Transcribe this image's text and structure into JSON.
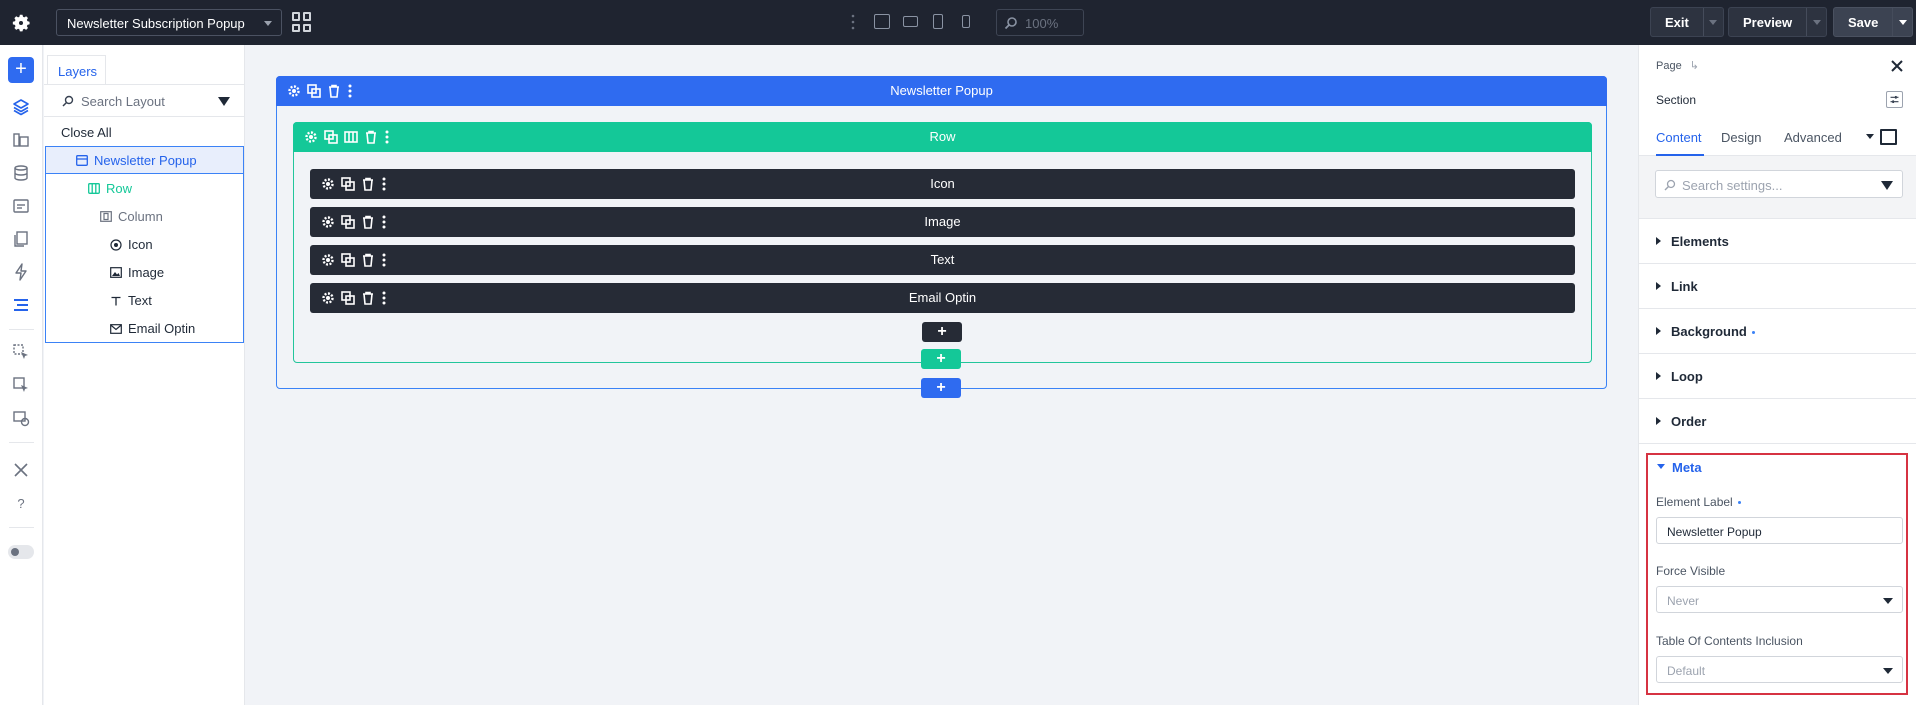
{
  "topbar": {
    "document_title": "Newsletter Subscription Popup",
    "zoom": "100%",
    "exit_label": "Exit",
    "preview_label": "Preview",
    "save_label": "Save"
  },
  "layers": {
    "tab_label": "Layers",
    "search_placeholder": "Search Layout",
    "close_all": "Close All",
    "items": [
      {
        "label": "Newsletter Popup",
        "icon": "section-icon"
      },
      {
        "label": "Row",
        "icon": "row-icon"
      },
      {
        "label": "Column",
        "icon": "column-icon"
      },
      {
        "label": "Icon",
        "icon": "icon-module-icon"
      },
      {
        "label": "Image",
        "icon": "image-icon"
      },
      {
        "label": "Text",
        "icon": "text-icon"
      },
      {
        "label": "Email Optin",
        "icon": "email-icon"
      }
    ]
  },
  "canvas": {
    "section_label": "Newsletter Popup",
    "row_label": "Row",
    "modules": [
      "Icon",
      "Image",
      "Text",
      "Email Optin"
    ]
  },
  "settings": {
    "breadcrumb": "Page",
    "breadcrumb_arrow": "↳",
    "title": "Section",
    "tabs": [
      "Content",
      "Design",
      "Advanced"
    ],
    "search_placeholder": "Search settings...",
    "groups": [
      "Elements",
      "Link",
      "Background",
      "Loop",
      "Order"
    ],
    "meta": {
      "label": "Meta",
      "element_label_title": "Element Label",
      "element_label_value": "Newsletter Popup",
      "force_visible_title": "Force Visible",
      "force_visible_value": "Never",
      "toc_title": "Table Of Contents Inclusion",
      "toc_value": "Default"
    }
  },
  "colors": {
    "section": "#2f6bf0",
    "row": "#14c898",
    "module": "#262b36",
    "highlight": "#d63342"
  }
}
